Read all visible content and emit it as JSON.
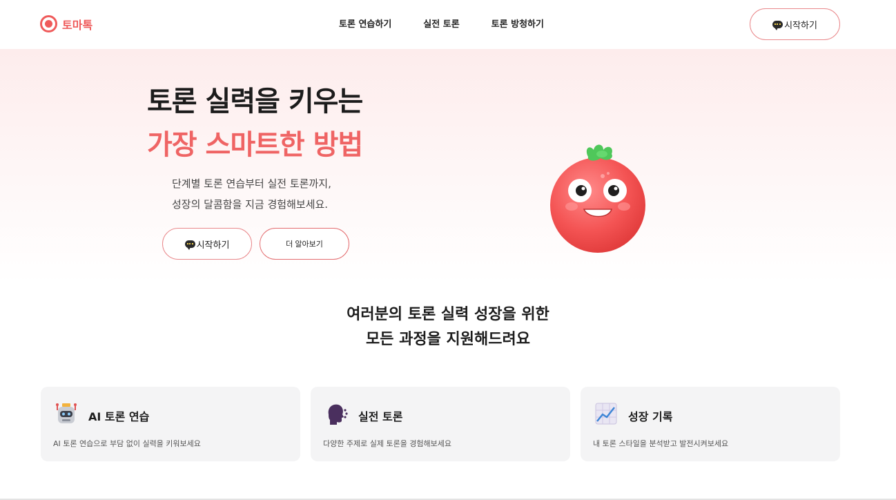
{
  "header": {
    "logo_text": "토마톡",
    "nav": [
      "토론 연습하기",
      "실전 토론",
      "토론 방청하기"
    ],
    "cta_label": "시작하기"
  },
  "hero": {
    "title_line1": "토론 실력을 키우는",
    "title_line2": "가장 스마트한 방법",
    "desc_line1": "단계별 토론 연습부터 실전 토론까지,",
    "desc_line2": "성장의 달콤함을 지금 경험해보세요.",
    "start_label": "시작하기",
    "more_label": "더 알아보기"
  },
  "section": {
    "title_line1": "여러분의 토론 실력 성장을 위한",
    "title_line2": "모든 과정을 지원해드려요"
  },
  "features": [
    {
      "icon": "robot-icon",
      "title": "AI 토론 연습",
      "desc": "AI 토론 연습으로 부담 없이 실력을 키워보세요"
    },
    {
      "icon": "speaking-head-icon",
      "title": "실전 토론",
      "desc": "다양한 주제로 실제 토론을 경험해보세요"
    },
    {
      "icon": "chart-increasing-icon",
      "title": "성장 기록",
      "desc": "내 토론 스타일을 분석받고 발전시켜보세요"
    }
  ],
  "colors": {
    "brand": "#ef5b5b",
    "button_border": "#e9878a",
    "card_bg": "#f4f4f5"
  }
}
